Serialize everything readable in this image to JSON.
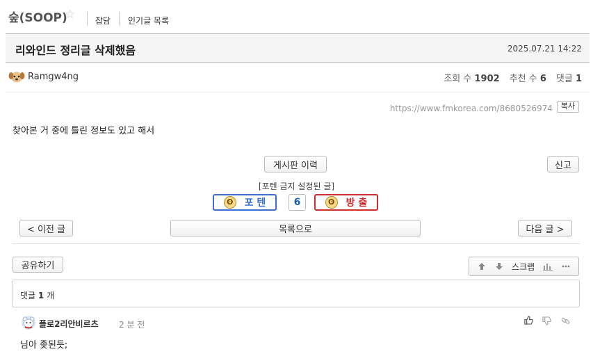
{
  "header": {
    "board_title": "숲(SOOP)",
    "star_icon": "☆",
    "nav": [
      "잡담",
      "인기글 목록"
    ]
  },
  "post": {
    "title": "리와인드 정리글 삭제했음",
    "datetime": "2025.07.21 14:22",
    "author": "Ramgw4ng",
    "stats": {
      "views_label": "조회 수",
      "views": "1902",
      "votes_label": "추천 수",
      "votes": "6",
      "comments_label": "댓글",
      "comments": "1"
    },
    "url": "https://www.fmkorea.com/8680526974",
    "copy_label": "복사",
    "content": "찾아본 거 중에 틀린 정보도 있고 해서"
  },
  "actions": {
    "history_label": "게시판 이력",
    "report_label": "신고",
    "ban_note": "[포텐 금지 설정된 글]",
    "poten_label": "포 텐",
    "vote_count": "6",
    "bang_label": "방 출",
    "prev_label": "< 이전 글",
    "list_label": "목록으로",
    "next_label": "다음 글 >",
    "share_label": "공유하기",
    "scrap_label": "스크랩"
  },
  "comments": {
    "header_prefix": "댓글",
    "count": "1",
    "header_suffix": "개",
    "items": [
      {
        "author": "플로2리안비르츠",
        "time": "2 분 전",
        "text": "님아 좆된듯;"
      }
    ]
  },
  "colors": {
    "poten_blue": "#3c6fcf",
    "bang_red": "#cc2f2f",
    "vote_number": "#1f5fb0"
  },
  "icons": [
    "star-outline-icon",
    "dog-avatar-icon",
    "up-arrow-icon",
    "down-arrow-icon",
    "bar-chart-icon",
    "more-icon",
    "thumbs-up-icon",
    "thumbs-down-icon",
    "link-icon"
  ]
}
